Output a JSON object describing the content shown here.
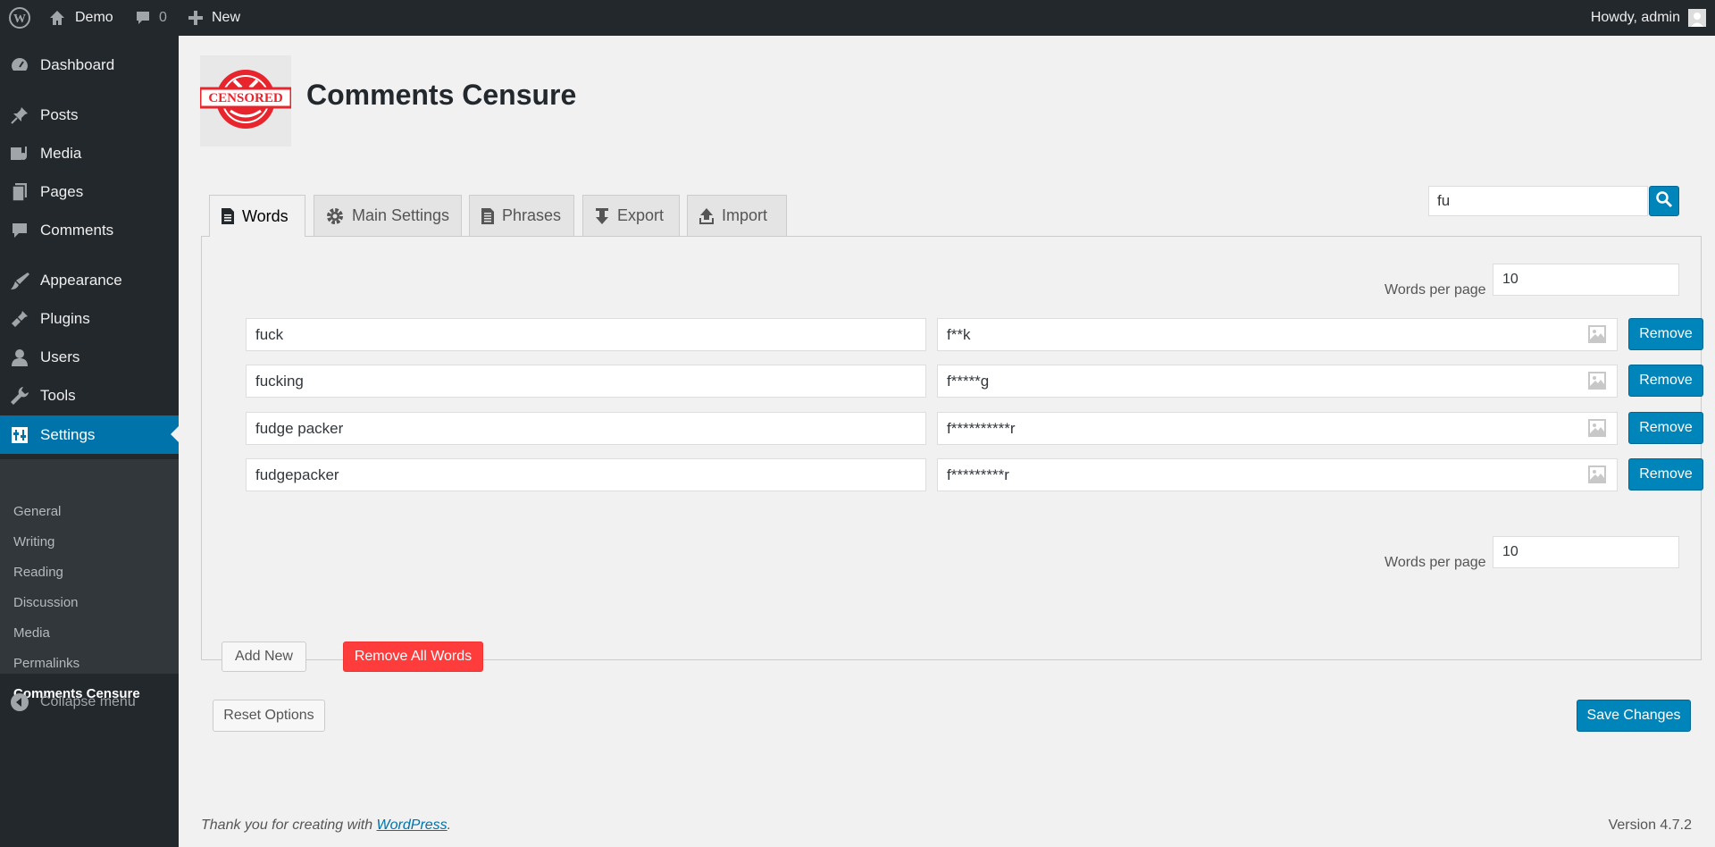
{
  "adminbar": {
    "site_name": "Demo",
    "comments_count": "0",
    "new_label": "New",
    "howdy": "Howdy, admin"
  },
  "sidebar": {
    "items": [
      {
        "label": "Dashboard",
        "icon": "dashboard-icon"
      },
      {
        "label": "Posts",
        "icon": "pin-icon"
      },
      {
        "label": "Media",
        "icon": "media-icon"
      },
      {
        "label": "Pages",
        "icon": "pages-icon"
      },
      {
        "label": "Comments",
        "icon": "comment-icon"
      },
      {
        "label": "Appearance",
        "icon": "brush-icon"
      },
      {
        "label": "Plugins",
        "icon": "plug-icon"
      },
      {
        "label": "Users",
        "icon": "user-icon"
      },
      {
        "label": "Tools",
        "icon": "wrench-icon"
      },
      {
        "label": "Settings",
        "icon": "settings-icon"
      }
    ],
    "submenu": [
      "General",
      "Writing",
      "Reading",
      "Discussion",
      "Media",
      "Permalinks",
      "Comments Censure"
    ],
    "collapse_label": "Collapse menu"
  },
  "page": {
    "title": "Comments Censure",
    "logo_text": "CENSORED",
    "tabs": [
      {
        "label": "Words",
        "icon": "document-icon"
      },
      {
        "label": "Main Settings",
        "icon": "gear-icon"
      },
      {
        "label": "Phrases",
        "icon": "document-lines-icon"
      },
      {
        "label": "Export",
        "icon": "download-icon"
      },
      {
        "label": "Import",
        "icon": "upload-icon"
      }
    ],
    "search_value": "fu"
  },
  "words": {
    "per_page_label": "Words per page",
    "per_page_value": "10",
    "rows": [
      {
        "word": "fuck",
        "replacement": "f**k"
      },
      {
        "word": "fucking",
        "replacement": "f*****g"
      },
      {
        "word": "fudge packer",
        "replacement": "f**********r"
      },
      {
        "word": "fudgepacker",
        "replacement": "f*********r"
      }
    ],
    "remove_label": "Remove",
    "add_new_label": "Add New",
    "remove_all_label": "Remove All Words"
  },
  "actions": {
    "reset_label": "Reset Options",
    "save_label": "Save Changes"
  },
  "footer": {
    "thanks_prefix": "Thank you for creating with ",
    "link_text": "WordPress",
    "suffix": ".",
    "version": "Version 4.7.2"
  },
  "colors": {
    "admin_dark": "#23282d",
    "accent": "#0073aa",
    "primary_button": "#0085ba",
    "danger_button": "#ff3c3c"
  }
}
